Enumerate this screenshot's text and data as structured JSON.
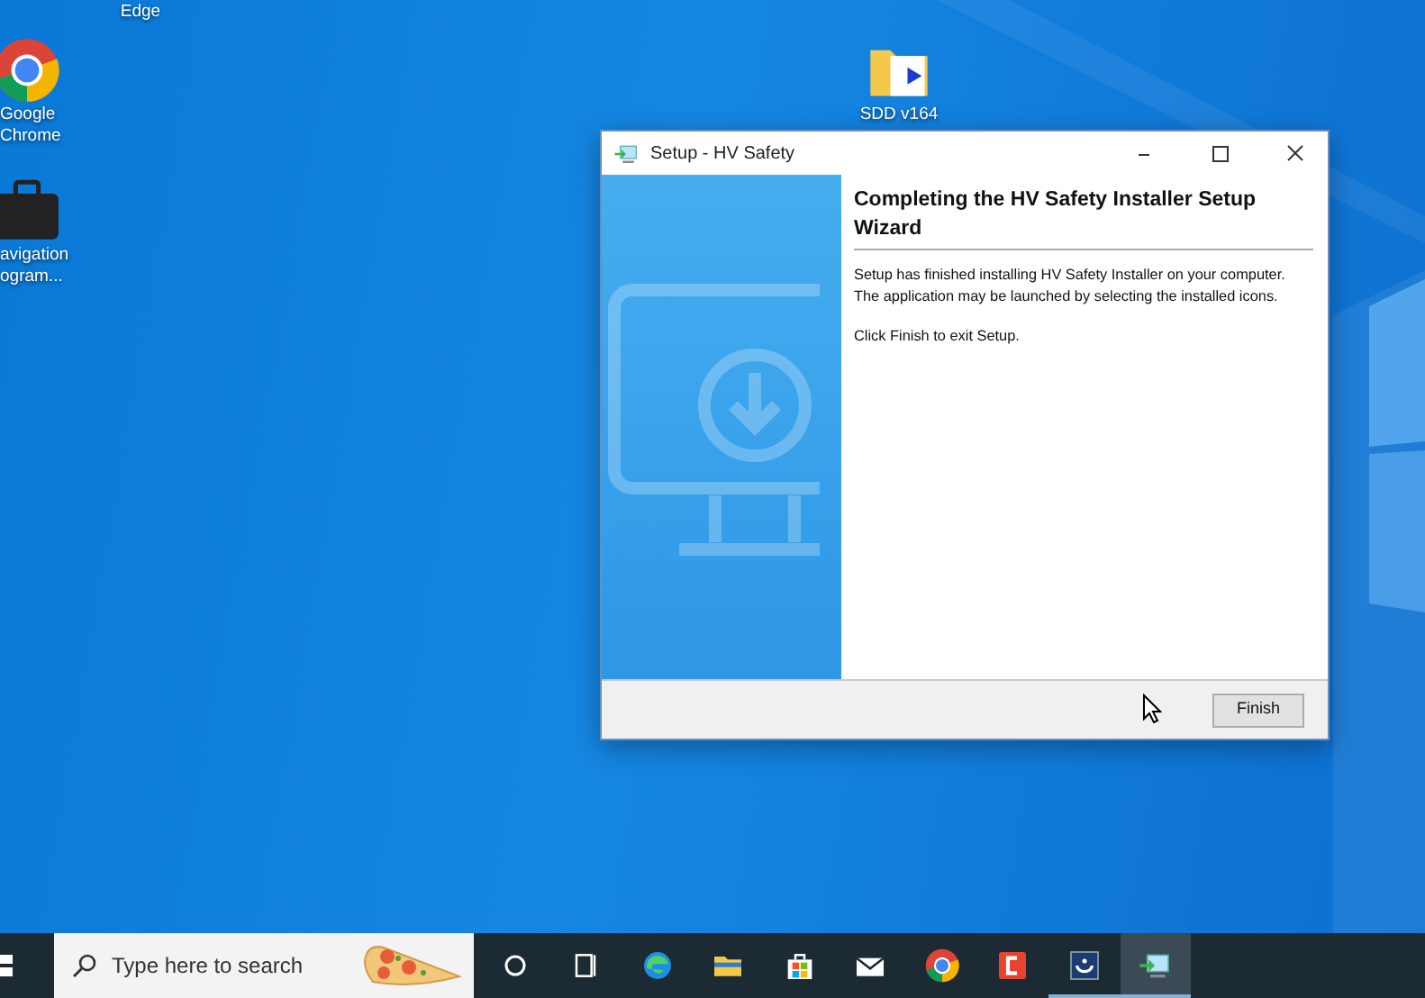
{
  "desktop_icons": [
    {
      "kind": "none",
      "lines": [
        "Edge"
      ]
    },
    {
      "kind": "chrome",
      "lines": [
        "Google",
        "Chrome"
      ]
    },
    {
      "kind": "briefcase",
      "lines": [
        "avigation",
        "ogram..."
      ]
    },
    {
      "kind": "folder",
      "lines": [
        "SDD v164"
      ]
    }
  ],
  "window": {
    "title": "Setup - HV Safety",
    "heading": "Completing the HV Safety Installer Setup Wizard",
    "paragraphs": [
      "Setup has finished installing HV Safety Installer on your computer. The application may be launched by selecting the installed icons.",
      "Click Finish to exit Setup."
    ],
    "buttons": [
      "Finish"
    ]
  },
  "taskbar": {
    "search": {
      "placeholder": "Type here to search"
    },
    "apps": [
      {
        "kind": "cortana",
        "running": false,
        "selected": false
      },
      {
        "kind": "taskview",
        "running": false,
        "selected": false
      },
      {
        "kind": "edge",
        "running": false,
        "selected": false
      },
      {
        "kind": "explorer",
        "running": false,
        "selected": false
      },
      {
        "kind": "store",
        "running": false,
        "selected": false
      },
      {
        "kind": "mail",
        "running": false,
        "selected": false
      },
      {
        "kind": "chrome",
        "running": false,
        "selected": false
      },
      {
        "kind": "redapp",
        "running": false,
        "selected": false
      },
      {
        "kind": "bluebox",
        "running": true,
        "selected": false
      },
      {
        "kind": "setup",
        "running": true,
        "selected": true
      }
    ]
  }
}
